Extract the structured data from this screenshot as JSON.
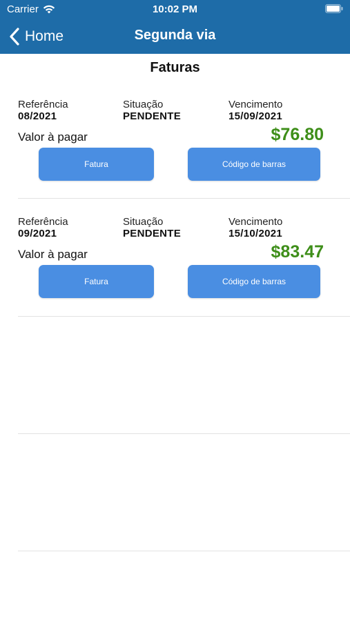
{
  "status_bar": {
    "carrier": "Carrier",
    "time": "10:02 PM"
  },
  "nav": {
    "back_label": "Home",
    "title": "Segunda via"
  },
  "page_title": "Faturas",
  "invoices": [
    {
      "referencia_label": "Referência",
      "referencia": "08/2021",
      "situacao_label": "Situação",
      "situacao": "PENDENTE",
      "vencimento_label": "Vencimento",
      "vencimento": "15/09/2021",
      "valor_label": "Valor à pagar",
      "valor": "$76.80",
      "fatura_button": "Fatura",
      "codigo_button": "Código de barras"
    },
    {
      "referencia_label": "Referência",
      "referencia": "09/2021",
      "situacao_label": "Situação",
      "situacao": "PENDENTE",
      "vencimento_label": "Vencimento",
      "vencimento": "15/10/2021",
      "valor_label": "Valor à pagar",
      "valor": "$83.47",
      "fatura_button": "Fatura",
      "codigo_button": "Código de barras"
    }
  ],
  "colors": {
    "header": "#1e6ca8",
    "button": "#4a8ee2",
    "amount": "#3e8e19"
  }
}
